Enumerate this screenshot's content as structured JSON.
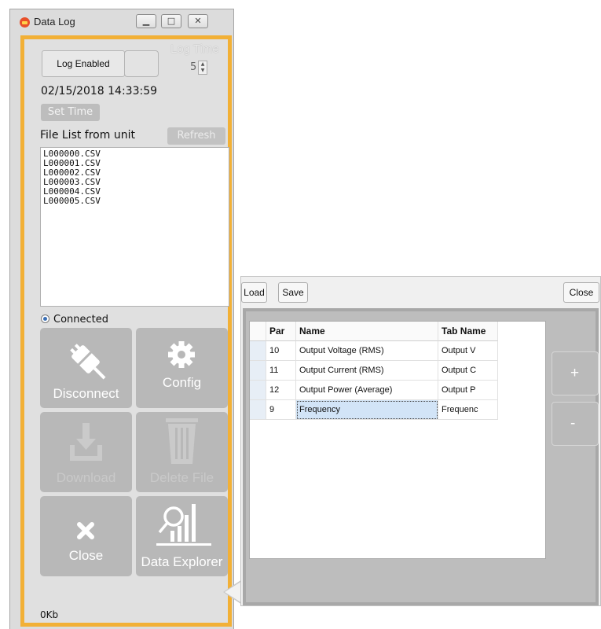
{
  "window": {
    "title": "Data Log"
  },
  "log": {
    "enabled_label": "Log Enabled",
    "time_label": "Log Time",
    "time_value": "5"
  },
  "datetime": "02/15/2018 14:33:59",
  "set_time_label": "Set Time",
  "file_list": {
    "label": "File List from unit",
    "refresh_label": "Refresh",
    "files": [
      "L000000.CSV",
      "L000001.CSV",
      "L000002.CSV",
      "L000003.CSV",
      "L000004.CSV",
      "L000005.CSV"
    ]
  },
  "connection": {
    "status": "Connected"
  },
  "actions": {
    "disconnect": "Disconnect",
    "config": "Config",
    "download": "Download",
    "delete_file": "Delete File",
    "close": "Close",
    "data_explorer": "Data Explorer"
  },
  "status_bar": "0Kb",
  "params_panel": {
    "load_label": "Load",
    "save_label": "Save",
    "close_label": "Close",
    "columns": [
      "Par",
      "Name",
      "Tab Name"
    ],
    "rows": [
      {
        "par": "10",
        "name": "Output Voltage (RMS)",
        "tab": "Output V"
      },
      {
        "par": "11",
        "name": "Output Current (RMS)",
        "tab": "Output C"
      },
      {
        "par": "12",
        "name": "Output Power (Average)",
        "tab": "Output P"
      },
      {
        "par": "9",
        "name": "Frequency",
        "tab": "Frequenc"
      }
    ],
    "add_label": "+",
    "remove_label": "-"
  },
  "colors": {
    "accent": "#f2b036",
    "tile": "#b8b8b8",
    "selection": "#d2e4f7"
  }
}
